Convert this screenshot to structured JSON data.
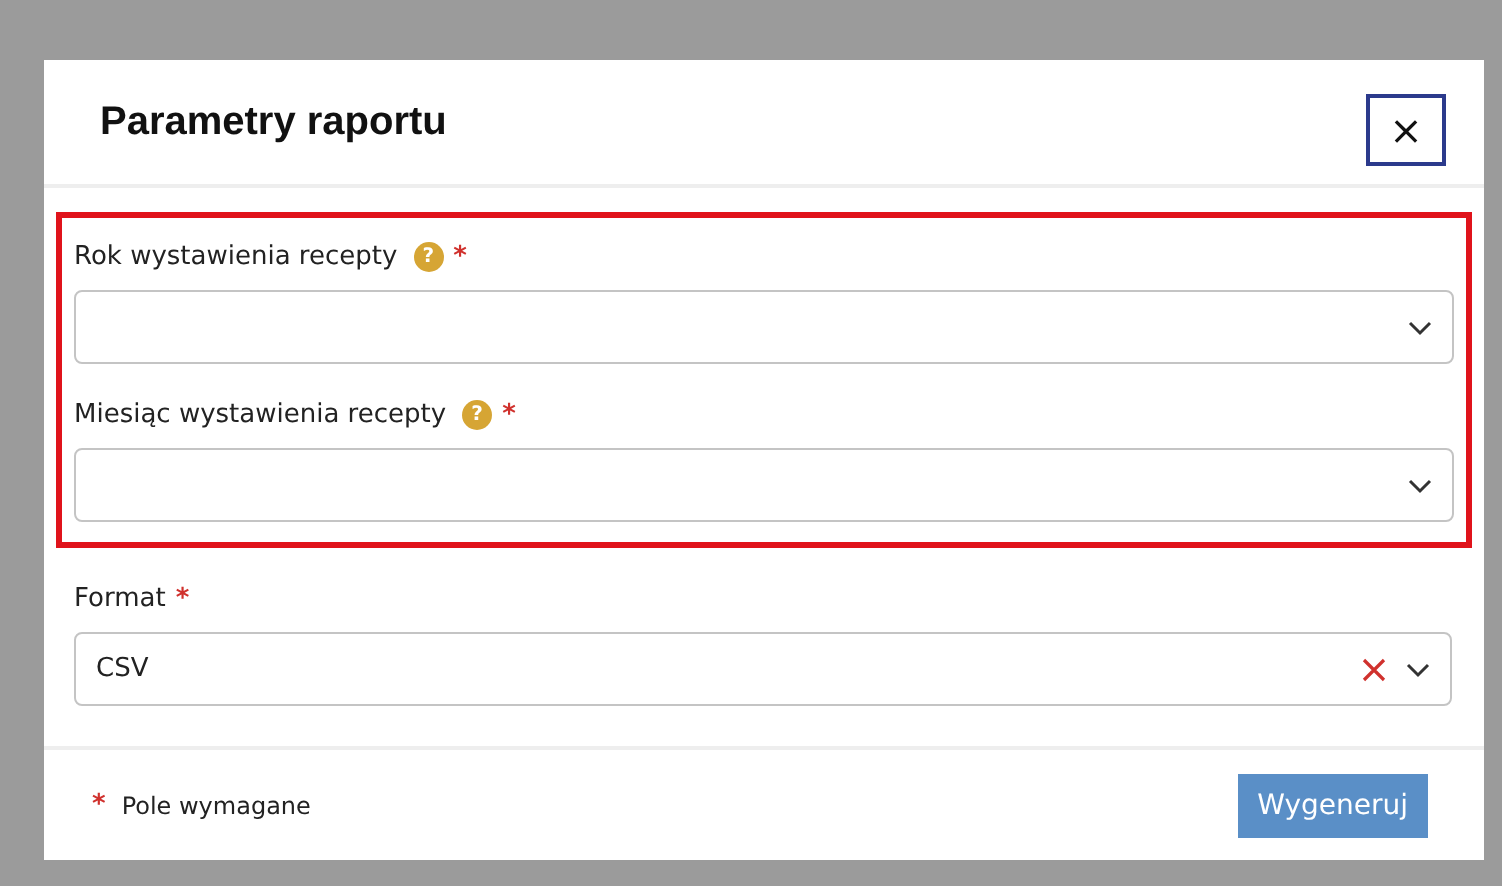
{
  "dialog": {
    "title": "Parametry raportu",
    "close": "×"
  },
  "highlight": {
    "fields": [
      {
        "label": "Rok wystawienia recepty",
        "help": "?",
        "required_mark": "*"
      },
      {
        "label": "Miesiąc wystawienia recepty",
        "help": "?",
        "required_mark": "*"
      }
    ]
  },
  "fields": [
    {
      "label": "Format",
      "required_mark": "*",
      "value": "CSV",
      "clearable": true
    }
  ],
  "footer": {
    "legend_mark": "*",
    "legend": "Pole wymagane",
    "button": "Wygeneruj"
  }
}
